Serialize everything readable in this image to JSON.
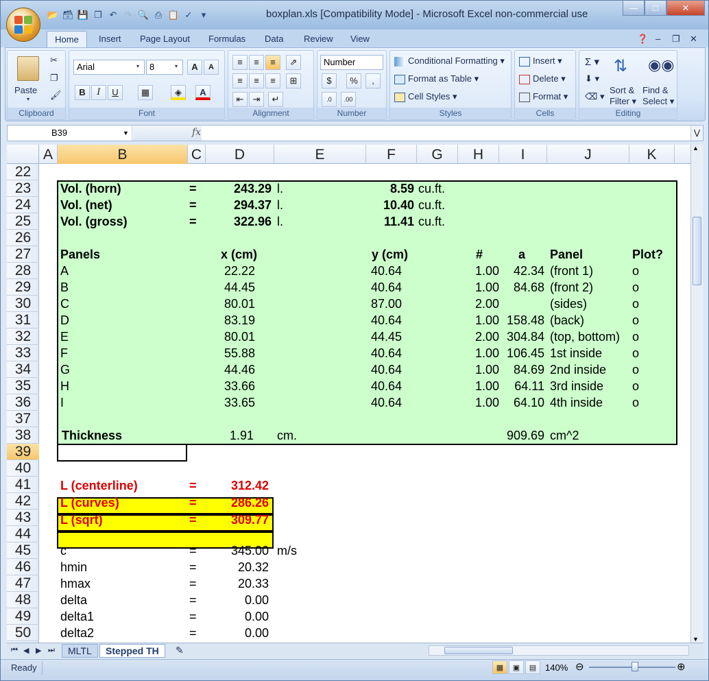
{
  "window": {
    "title": "boxplan.xls  [Compatibility Mode] - Microsoft Excel non-commercial use"
  },
  "ribbon": {
    "tabs": [
      "Home",
      "Insert",
      "Page Layout",
      "Formulas",
      "Data",
      "Review",
      "View"
    ],
    "clipboard": {
      "paste": "Paste",
      "label": "Clipboard"
    },
    "font": {
      "name": "Arial",
      "size": "8",
      "label": "Font"
    },
    "alignment": {
      "label": "Alignment"
    },
    "number": {
      "format": "Number",
      "label": "Number"
    },
    "styles": {
      "conditional": "Conditional Formatting",
      "table": "Format as Table",
      "cell": "Cell Styles",
      "label": "Styles"
    },
    "cells": {
      "insert": "Insert",
      "delete": "Delete",
      "format": "Format",
      "label": "Cells"
    },
    "editing": {
      "sort1": "Sort &",
      "sort2": "Filter",
      "find1": "Find &",
      "find2": "Select",
      "label": "Editing"
    }
  },
  "formula_bar": {
    "name_box": "B39",
    "formula": ""
  },
  "columns": [
    "A",
    "B",
    "C",
    "D",
    "E",
    "F",
    "G",
    "H",
    "I",
    "J",
    "K"
  ],
  "rows": [
    "22",
    "23",
    "24",
    "25",
    "26",
    "27",
    "28",
    "29",
    "30",
    "31",
    "32",
    "33",
    "34",
    "35",
    "36",
    "37",
    "38",
    "39",
    "40",
    "41",
    "42",
    "43",
    "44",
    "45",
    "46",
    "47",
    "48",
    "49",
    "50"
  ],
  "vol": [
    {
      "label": "Vol. (horn)",
      "eq": "=",
      "v": "243.29",
      "u": "l.",
      "cf": "8.59",
      "cu": "cu.ft."
    },
    {
      "label": "Vol. (net)",
      "eq": "=",
      "v": "294.37",
      "u": "l.",
      "cf": "10.40",
      "cu": "cu.ft."
    },
    {
      "label": "Vol. (gross)",
      "eq": "=",
      "v": "322.96",
      "u": "l.",
      "cf": "11.41",
      "cu": "cu.ft."
    }
  ],
  "panels_header": {
    "panels": "Panels",
    "x": "x (cm)",
    "y": "y (cm)",
    "n": "#",
    "a": "a",
    "panel": "Panel",
    "plot": "Plot?"
  },
  "panels": [
    {
      "name": "A",
      "x": "22.22",
      "y": "40.64",
      "n": "1.00",
      "a": "42.34",
      "panel": "(front 1)",
      "plot": "o"
    },
    {
      "name": "B",
      "x": "44.45",
      "y": "40.64",
      "n": "1.00",
      "a": "84.68",
      "panel": "(front 2)",
      "plot": "o"
    },
    {
      "name": "C",
      "x": "80.01",
      "y": "87.00",
      "n": "2.00",
      "a": "",
      "panel": "(sides)",
      "plot": "o"
    },
    {
      "name": "D",
      "x": "83.19",
      "y": "40.64",
      "n": "1.00",
      "a": "158.48",
      "panel": "(back)",
      "plot": "o"
    },
    {
      "name": "E",
      "x": "80.01",
      "y": "44.45",
      "n": "2.00",
      "a": "304.84",
      "panel": "(top, bottom)",
      "plot": "o"
    },
    {
      "name": "F",
      "x": "55.88",
      "y": "40.64",
      "n": "1.00",
      "a": "106.45",
      "panel": "1st inside",
      "plot": "o"
    },
    {
      "name": "G",
      "x": "44.46",
      "y": "40.64",
      "n": "1.00",
      "a": "84.69",
      "panel": "2nd inside",
      "plot": "o"
    },
    {
      "name": "H",
      "x": "33.66",
      "y": "40.64",
      "n": "1.00",
      "a": "64.11",
      "panel": "3rd inside",
      "plot": "o"
    },
    {
      "name": "I",
      "x": "33.65",
      "y": "40.64",
      "n": "1.00",
      "a": "64.10",
      "panel": "4th inside",
      "plot": "o"
    }
  ],
  "thickness": {
    "label": "Thickness",
    "v": "1.91",
    "u": "cm.",
    "area": "909.69",
    "au": "cm^2"
  },
  "lengths": [
    {
      "label": "L (centerline)",
      "eq": "=",
      "v": "312.42"
    },
    {
      "label": "L (curves)",
      "eq": "=",
      "v": "286.26"
    },
    {
      "label": "L (sqrt)",
      "eq": "=",
      "v": "309.77"
    }
  ],
  "params": [
    {
      "label": "c",
      "eq": "=",
      "v": "345.00",
      "u": "m/s"
    },
    {
      "label": "hmin",
      "eq": "=",
      "v": "20.32",
      "u": ""
    },
    {
      "label": "hmax",
      "eq": "=",
      "v": "20.33",
      "u": ""
    },
    {
      "label": "delta",
      "eq": "=",
      "v": "0.00",
      "u": ""
    },
    {
      "label": "delta1",
      "eq": "=",
      "v": "0.00",
      "u": ""
    },
    {
      "label": "delta2",
      "eq": "=",
      "v": "0.00",
      "u": ""
    }
  ],
  "sheet_tabs": [
    "MLTL",
    "Stepped TH"
  ],
  "status": {
    "ready": "Ready",
    "zoom": "140%"
  }
}
